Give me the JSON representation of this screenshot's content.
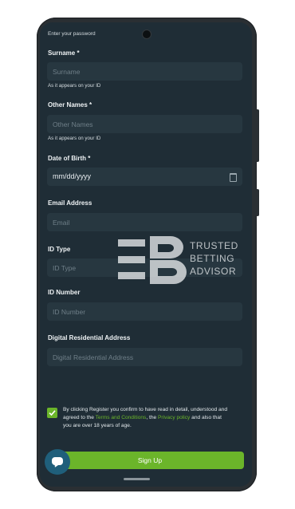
{
  "form": {
    "top_hint": "Enter your password",
    "surname": {
      "label": "Surname *",
      "placeholder": "Surname",
      "hint": "As it appears on your ID"
    },
    "other_names": {
      "label": "Other Names *",
      "placeholder": "Other Names",
      "hint": "As it appears on your ID"
    },
    "dob": {
      "label": "Date of Birth *",
      "value": "mm/dd/yyyy"
    },
    "email": {
      "label": "Email Address",
      "placeholder": "Email"
    },
    "id_type": {
      "label": "ID Type",
      "placeholder": "ID Type"
    },
    "id_number": {
      "label": "ID Number",
      "placeholder": "ID Number"
    },
    "address": {
      "label": "Digital Residential Address",
      "placeholder": "Digital Residential Address"
    }
  },
  "terms": {
    "checked": true,
    "text_1": "By clicking Register you confirm to have read in detail, understood and agreed to the ",
    "terms_link": "Terms and Conditions",
    "text_2": ", the ",
    "privacy_link": "Privacy policy",
    "text_3": " and also that you are over 18 years of age."
  },
  "buttons": {
    "sign_up": "Sign Up"
  },
  "watermark": {
    "line1": "TRUSTED",
    "line2": "BETTING",
    "line3": "ADVISOR"
  },
  "colors": {
    "accent": "#6bb52a",
    "background": "#1f2d36",
    "field": "#273740",
    "chat": "#1f5f7b"
  },
  "icons": {
    "chat": "chat-bubble-icon",
    "calendar": "calendar-icon",
    "check": "checkmark-icon"
  }
}
